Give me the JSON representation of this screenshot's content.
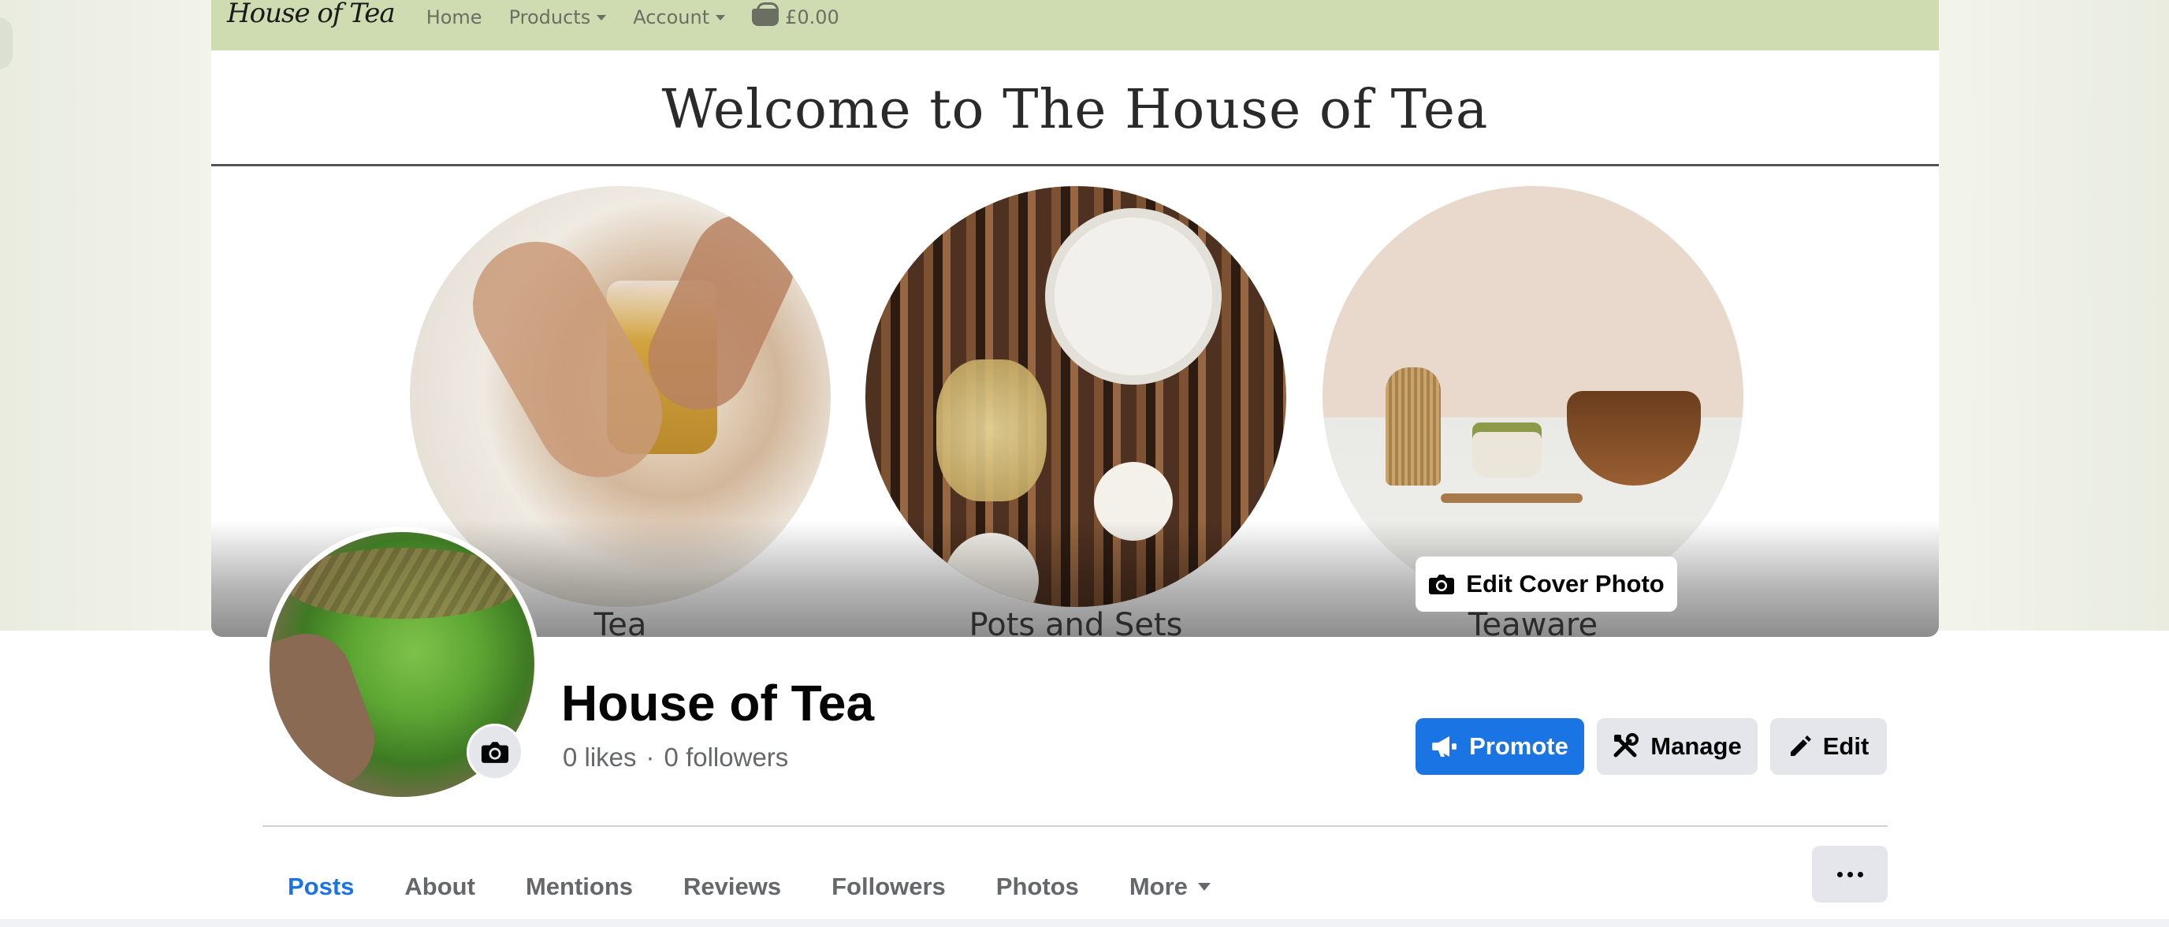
{
  "site": {
    "logo": "House of Tea",
    "nav": {
      "home": "Home",
      "products": "Products",
      "account": "Account",
      "cart_amount": "£0.00"
    },
    "welcome": "Welcome to The House of Tea",
    "categories": [
      {
        "label": "Tea"
      },
      {
        "label": "Pots and Sets"
      },
      {
        "label": "Teaware"
      }
    ]
  },
  "cover": {
    "edit_label": "Edit Cover Photo"
  },
  "profile": {
    "name": "House of Tea",
    "likes": "0 likes",
    "separator": "·",
    "followers": "0 followers"
  },
  "actions": {
    "promote": "Promote",
    "manage": "Manage",
    "edit": "Edit"
  },
  "tabs": [
    {
      "label": "Posts"
    },
    {
      "label": "About"
    },
    {
      "label": "Mentions"
    },
    {
      "label": "Reviews"
    },
    {
      "label": "Followers"
    },
    {
      "label": "Photos"
    },
    {
      "label": "More"
    }
  ],
  "colors": {
    "accent": "#1b74e4",
    "site_nav": "#cfdbb0",
    "button_grey": "#e4e6eb",
    "muted_text": "#65676b"
  },
  "icons": [
    "camera-icon",
    "megaphone-icon",
    "tools-icon",
    "pencil-icon",
    "caret-down-icon",
    "more-dots-icon",
    "cart-icon"
  ]
}
